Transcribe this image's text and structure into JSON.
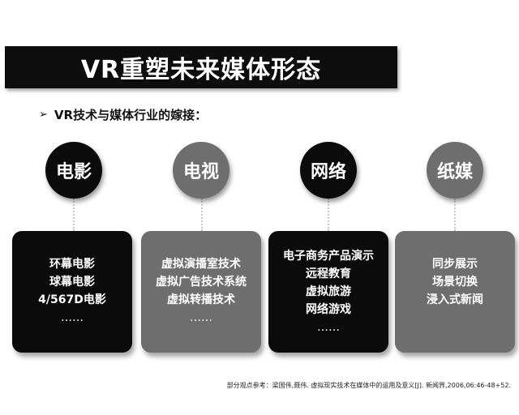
{
  "title": "VR重塑未来媒体形态",
  "subtitle": {
    "bullet_icon": "arrow-bullet-icon",
    "text": "VR技术与媒体行业的嫁接："
  },
  "categories": [
    {
      "name": "电影",
      "style": "dark",
      "items": [
        "环幕电影",
        "球幕电影",
        "4/567D电影",
        "……"
      ]
    },
    {
      "name": "电视",
      "style": "gray",
      "items": [
        "虚拟演播室技术",
        "虚拟广告技术系统",
        "虚拟转播技术",
        "……"
      ]
    },
    {
      "name": "网络",
      "style": "dark",
      "items": [
        "电子商务产品演示",
        "远程教育",
        "虚拟旅游",
        "网络游戏",
        "……"
      ]
    },
    {
      "name": "纸媒",
      "style": "gray",
      "items": [
        "同步展示",
        "场景切换",
        "浸入式新闻"
      ]
    }
  ],
  "footnote": "部分观点参考：梁国伟,聂伟. 虚拟现实技术在媒体中的运用及意义[J]. 新闻界,2006,06:46-48+52.",
  "colors": {
    "dark": "#0b0b0b",
    "gray": "#6e6e6e",
    "title_bar": "#0d0d0d"
  }
}
